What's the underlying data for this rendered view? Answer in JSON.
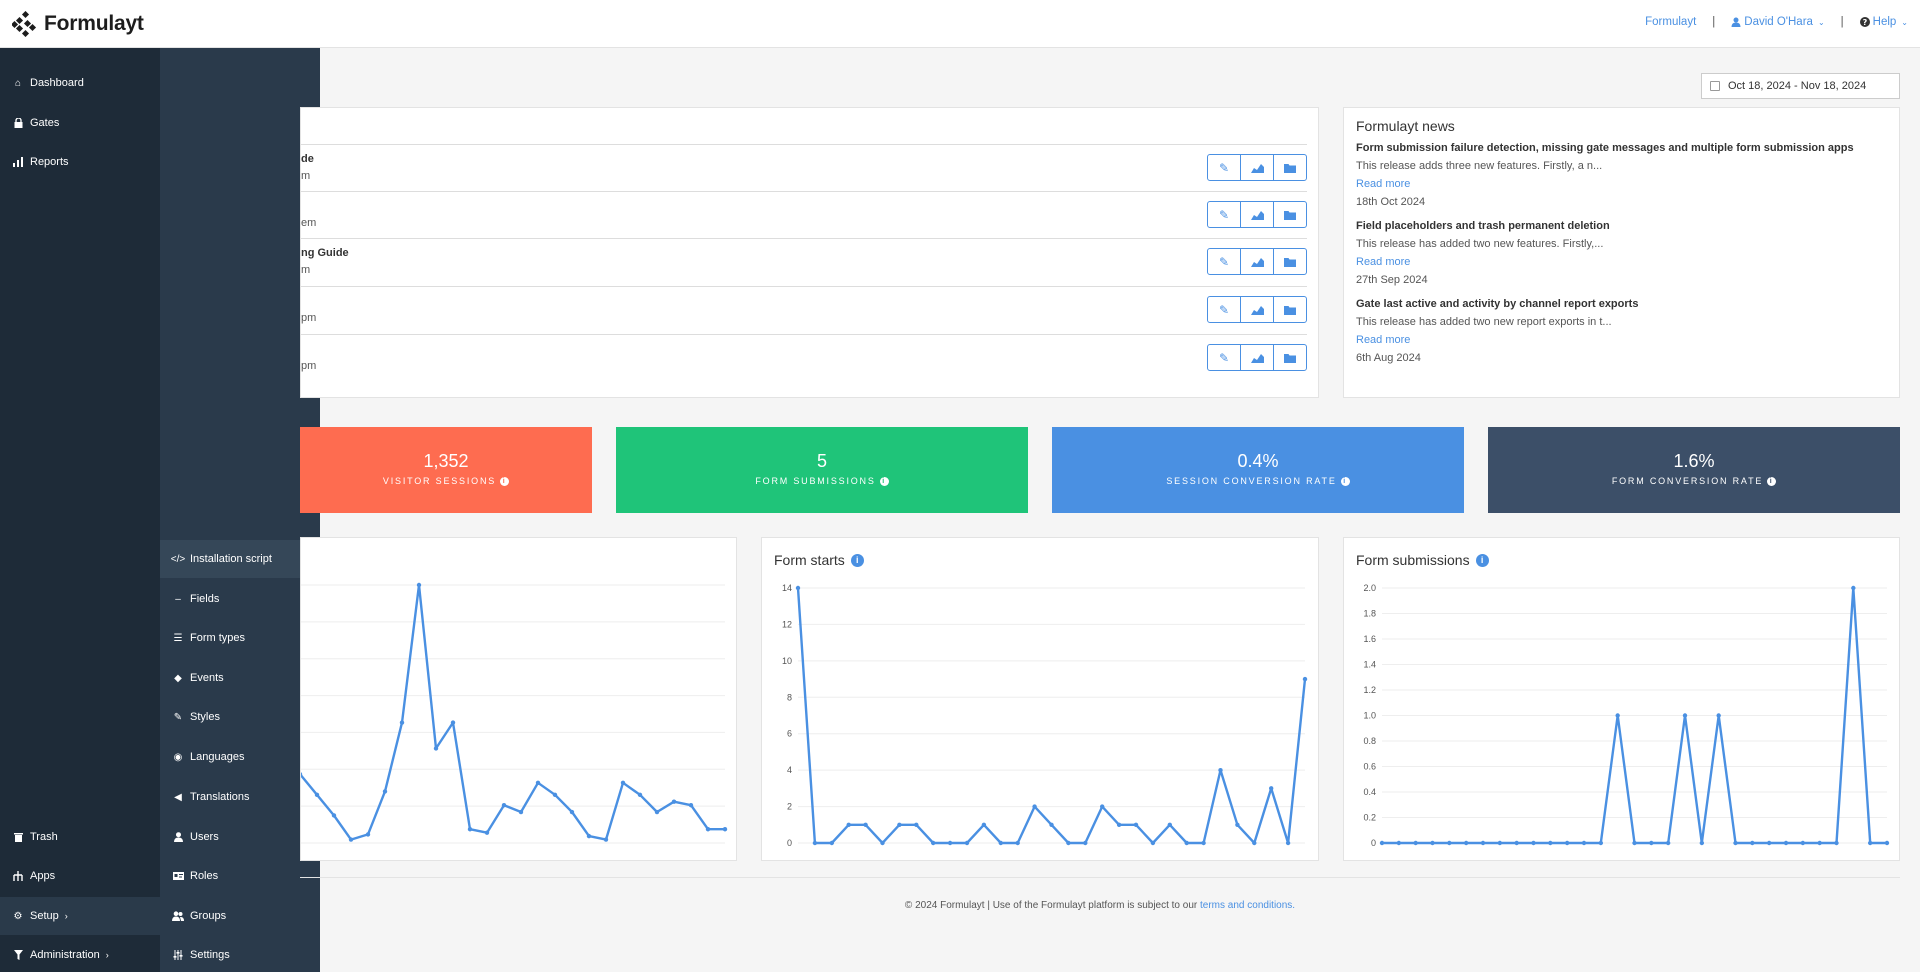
{
  "header": {
    "app_name": "Formulayt",
    "nav": [
      {
        "label": "Formulayt",
        "icon": ""
      },
      {
        "label": "David O'Hara",
        "icon": "user-icon"
      },
      {
        "label": "Help",
        "icon": "question-circle-icon"
      }
    ]
  },
  "sidebar": {
    "items": [
      {
        "label": "Dashboard",
        "icon": "home-icon"
      },
      {
        "label": "Gates",
        "icon": "lock-icon"
      },
      {
        "label": "Reports",
        "icon": "bar-chart-icon"
      },
      {
        "label": "Trash",
        "icon": "trash-icon"
      },
      {
        "label": "Apps",
        "icon": "apps-icon"
      },
      {
        "label": "Setup",
        "icon": "gear-icon"
      },
      {
        "label": "Administration",
        "icon": "filter-icon"
      }
    ]
  },
  "submenu": {
    "items": [
      {
        "label": "Installation script",
        "icon": "code-icon"
      },
      {
        "label": "Fields",
        "icon": "minus-icon"
      },
      {
        "label": "Form types",
        "icon": "list-icon"
      },
      {
        "label": "Events",
        "icon": "bullhorn-icon"
      },
      {
        "label": "Styles",
        "icon": "pencil-icon"
      },
      {
        "label": "Languages",
        "icon": "database-icon"
      },
      {
        "label": "Translations",
        "icon": "megaphone-icon"
      },
      {
        "label": "Users",
        "icon": "user-icon"
      },
      {
        "label": "Roles",
        "icon": "id-card-icon"
      },
      {
        "label": "Groups",
        "icon": "users-icon"
      },
      {
        "label": "Settings",
        "icon": "sliders-icon"
      }
    ]
  },
  "date_range": "Oct 18, 2024 - Nov 18, 2024",
  "gates": [
    {
      "name": "de",
      "sub": "m"
    },
    {
      "name": "",
      "sub": "em"
    },
    {
      "name": "ng Guide",
      "sub": "m"
    },
    {
      "name": "",
      "sub": "pm"
    },
    {
      "name": "",
      "sub": "pm"
    }
  ],
  "news": {
    "title": "Formulayt news",
    "items": [
      {
        "heading": "Form submission failure detection, missing gate messages and multiple form submission apps",
        "summary": "This release adds three new features. Firstly, a n...",
        "link": "Read more",
        "date": "18th Oct 2024"
      },
      {
        "heading": "Field placeholders and trash permanent deletion",
        "summary": "This release has added two new features. Firstly,...",
        "link": "Read more",
        "date": "27th Sep 2024"
      },
      {
        "heading": "Gate last active and activity by channel report exports",
        "summary": "This release has added two new report exports in t...",
        "link": "Read more",
        "date": "6th Aug 2024"
      }
    ]
  },
  "stats": [
    {
      "value": "1,352",
      "label": "VISITOR SESSIONS",
      "color": "#fe6c50"
    },
    {
      "value": "5",
      "label": "FORM SUBMISSIONS",
      "color": "#1fc479"
    },
    {
      "value": "0.4%",
      "label": "SESSION CONVERSION RATE",
      "color": "#4a90e2"
    },
    {
      "value": "1.6%",
      "label": "FORM CONVERSION RATE",
      "color": "#3c4f68"
    }
  ],
  "chart_data": [
    {
      "type": "line",
      "title": "",
      "values": [
        4,
        2.8,
        1.6,
        0.2,
        0.5,
        3,
        7,
        15,
        5.5,
        7,
        0.8,
        0.6,
        2.2,
        1.8,
        3.5,
        2.8,
        1.8,
        0.4,
        0.2,
        3.5,
        2.8,
        1.8,
        2.4,
        2.2,
        0.8,
        0.8
      ],
      "ylim": [
        0,
        15
      ],
      "color": "#4a90e2"
    },
    {
      "type": "line",
      "title": "Form starts",
      "values": [
        14,
        0,
        0,
        1,
        1,
        0,
        1,
        1,
        0,
        0,
        0,
        1,
        0,
        0,
        2,
        1,
        0,
        0,
        2,
        1,
        1,
        0,
        1,
        0,
        0,
        4,
        1,
        0,
        3,
        0,
        9
      ],
      "ylim": [
        0,
        14
      ],
      "yticks": [
        "0",
        "2",
        "4",
        "6",
        "8",
        "10",
        "12",
        "14"
      ],
      "color": "#4a90e2"
    },
    {
      "type": "line",
      "title": "Form submissions",
      "values": [
        0,
        0,
        0,
        0,
        0,
        0,
        0,
        0,
        0,
        0,
        0,
        0,
        0,
        0,
        1,
        0,
        0,
        0,
        1,
        0,
        1,
        0,
        0,
        0,
        0,
        0,
        0,
        0,
        2,
        0,
        0
      ],
      "ylim": [
        0,
        2
      ],
      "yticks": [
        "0",
        "0.2",
        "0.4",
        "0.6",
        "0.8",
        "1.0",
        "1.2",
        "1.4",
        "1.6",
        "1.8",
        "2.0"
      ],
      "color": "#4a90e2"
    }
  ],
  "footer": {
    "text": "© 2024 Formulayt | Use of the Formulayt platform is subject to our ",
    "link": "terms and conditions."
  }
}
